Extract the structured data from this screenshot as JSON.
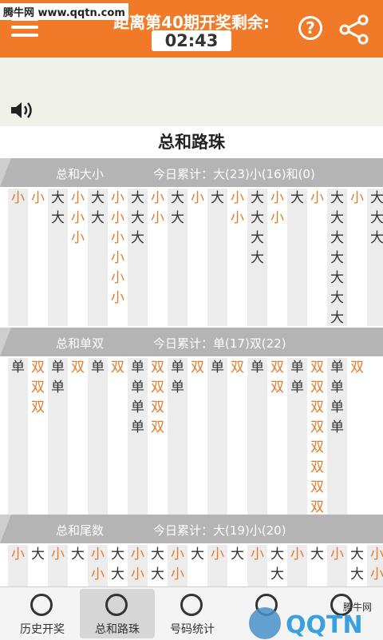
{
  "watermark_top": "腾牛网 www.qqtn.com",
  "header": {
    "title": "距离第40期开奖剩余:",
    "timer": "02:43"
  },
  "page_title": "总和路珠",
  "sections": [
    {
      "name": "总和大小",
      "stat": "今日累计：大(23)小(16)和(0)",
      "columns": [
        [
          "小"
        ],
        [
          "小"
        ],
        [
          "大",
          "大"
        ],
        [
          "小",
          "小",
          "小"
        ],
        [
          "大",
          "大"
        ],
        [
          "小",
          "小",
          "小",
          "小",
          "小",
          "小"
        ],
        [
          "大",
          "大",
          "大"
        ],
        [
          "小",
          "小"
        ],
        [
          "大",
          "大"
        ],
        [
          "小"
        ],
        [
          "大"
        ],
        [
          "小",
          "小"
        ],
        [
          "大",
          "大",
          "大",
          "大"
        ],
        [
          "小",
          "小"
        ],
        [
          "大"
        ],
        [
          "小"
        ],
        [
          "大",
          "大",
          "大",
          "大",
          "大",
          "大",
          "大"
        ],
        [
          "小"
        ],
        [
          "大",
          "大",
          "大"
        ]
      ]
    },
    {
      "name": "总和单双",
      "stat": "今日累计：单(17)双(22)",
      "columns": [
        [
          "单"
        ],
        [
          "双",
          "双",
          "双"
        ],
        [
          "单",
          "单"
        ],
        [
          "双"
        ],
        [
          "单"
        ],
        [
          "双"
        ],
        [
          "单",
          "单",
          "单",
          "单"
        ],
        [
          "双",
          "双",
          "双",
          "双"
        ],
        [
          "单",
          "单"
        ],
        [
          "双"
        ],
        [
          "单"
        ],
        [
          "双"
        ],
        [
          "单"
        ],
        [
          "双",
          "双"
        ],
        [
          "单",
          "单"
        ],
        [
          "双",
          "双",
          "双",
          "双",
          "双",
          "双",
          "双",
          "双"
        ],
        [
          "单",
          "单",
          "单",
          "单"
        ],
        [
          "双"
        ]
      ]
    },
    {
      "name": "总和尾数",
      "stat": "今日累计：大(19)小(20)",
      "columns": [
        [
          "小"
        ],
        [
          "大"
        ],
        [
          "小"
        ],
        [
          "大"
        ],
        [
          "小",
          "小"
        ],
        [
          "大",
          "大"
        ],
        [
          "小",
          "小"
        ],
        [
          "大",
          "大"
        ],
        [
          "小",
          "小"
        ],
        [
          "大"
        ],
        [
          "小"
        ],
        [
          "大"
        ],
        [
          "小"
        ],
        [
          "大",
          "大"
        ],
        [
          "小"
        ],
        [
          "大"
        ],
        [
          "小"
        ],
        [
          "大",
          "大"
        ],
        [
          "小",
          "小"
        ]
      ]
    }
  ],
  "tabs": [
    {
      "label": "历史开奖",
      "icon": "list-icon"
    },
    {
      "label": "总和路珠",
      "icon": "sum-icon"
    },
    {
      "label": "号码统计",
      "icon": "pie-chart-icon"
    },
    {
      "label": "",
      "icon": "tab-icon-4"
    },
    {
      "label": "",
      "icon": "tab-icon-5"
    }
  ],
  "watermark_bottom": {
    "logo": "QQTN",
    "site": "腾牛网"
  },
  "colors": {
    "accent": "#f07a28",
    "big": "#333333",
    "small": "#e67a2a",
    "header_gray": "#b4b4b4"
  }
}
